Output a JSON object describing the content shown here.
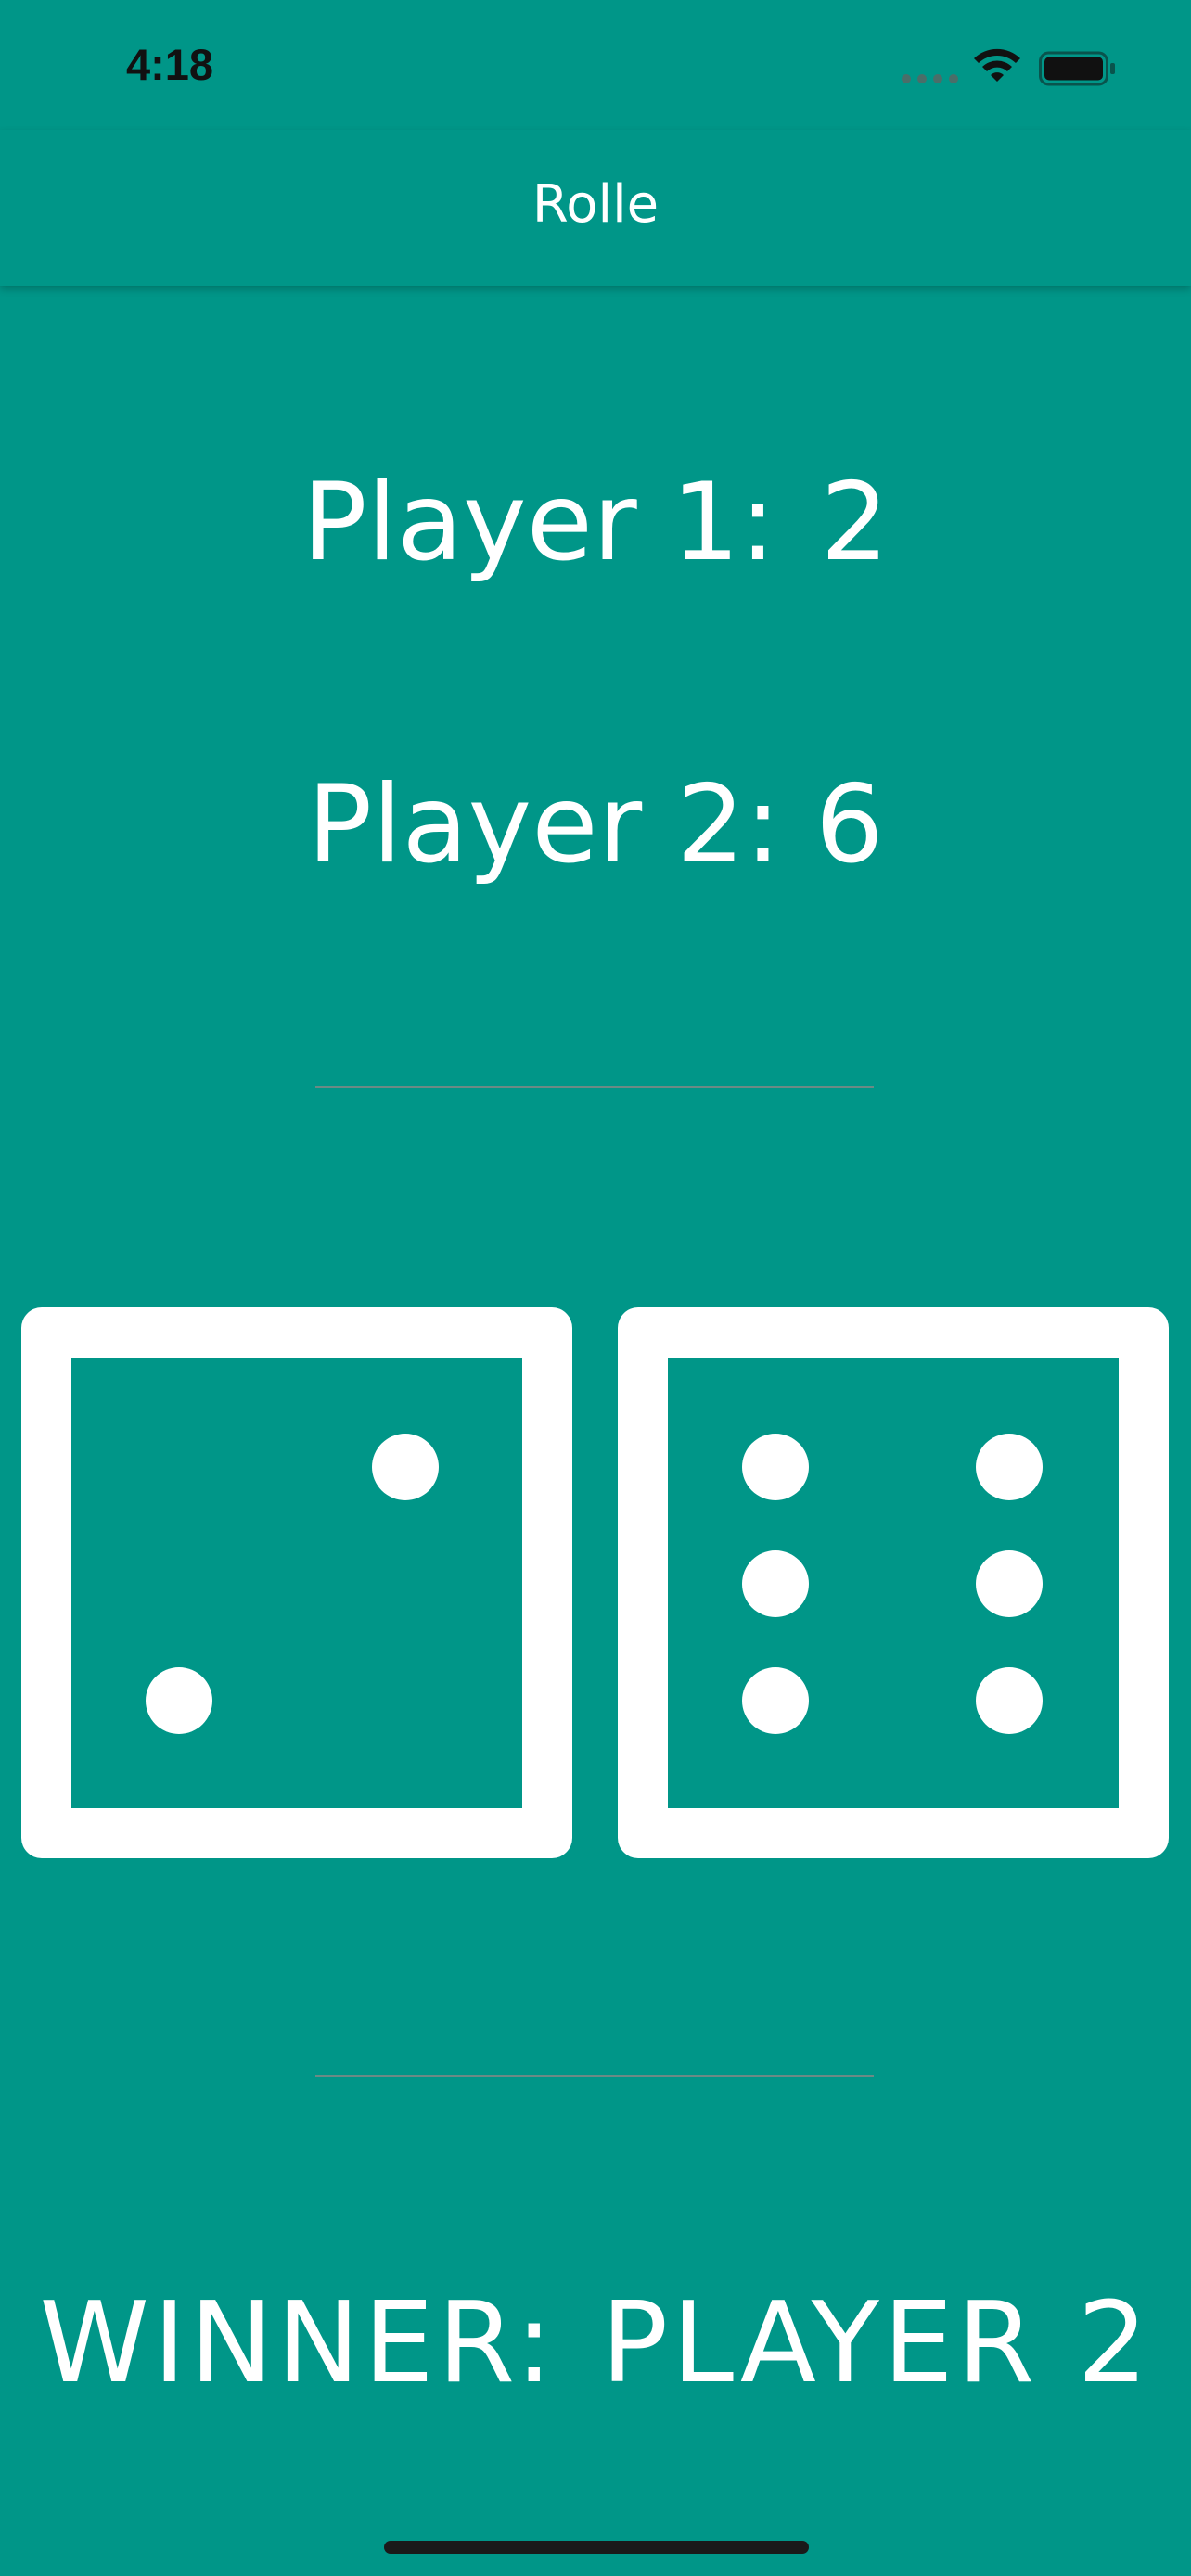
{
  "status_bar": {
    "time": "4:18"
  },
  "app_bar": {
    "title": "Rolle"
  },
  "scores": {
    "player1_label": "Player 1:",
    "player1_value": "2",
    "player2_label": "Player 2:",
    "player2_value": "6"
  },
  "dice": {
    "left_value": 2,
    "right_value": 6
  },
  "result": {
    "label": "WINNER:",
    "value": "PLAYER 2"
  },
  "colors": {
    "background": "#009688",
    "foreground": "#ffffff"
  }
}
